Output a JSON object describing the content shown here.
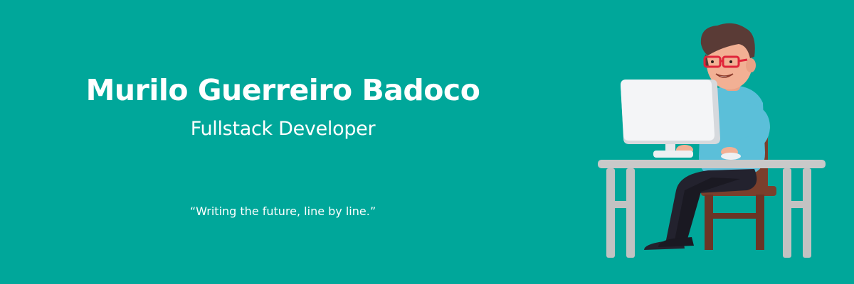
{
  "banner": {
    "name": "Murilo Guerreiro Badoco",
    "role": "Fullstack Developer",
    "quote": "“Writing the future, line by line.”"
  },
  "colors": {
    "background": "#00a79a",
    "text": "#ffffff",
    "shirt": "#5bbfd9",
    "hair": "#5a3b36",
    "skin": "#f2b094",
    "glasses": "#e0253a",
    "pants": "#23222e",
    "chair": "#7a3f2c",
    "desk": "#c9c9c9",
    "monitor": "#f4f5f7"
  },
  "illustration": {
    "icon": "developer-at-desk-icon"
  }
}
